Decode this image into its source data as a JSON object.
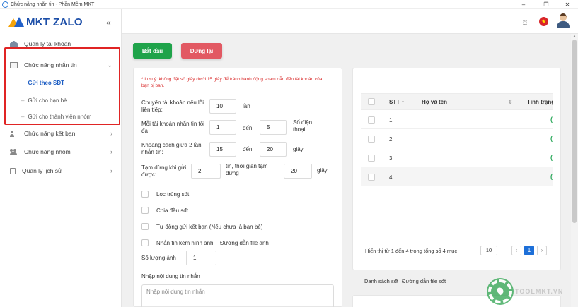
{
  "window": {
    "title": "Chức năng nhắn tin - Phần Mềm MKT",
    "minimize": "–",
    "maximize": "❐",
    "close": "✕"
  },
  "logo": {
    "text": "MKT ZALO"
  },
  "sidebar": {
    "collapse_glyph": "«",
    "items": [
      {
        "label": "Quản lý tài khoản",
        "icon": "house-icon"
      },
      {
        "label": "Chức năng nhắn tin",
        "icon": "mail-icon",
        "chevron": "⌄"
      },
      {
        "label": "Chức năng kết bạn",
        "icon": "user-plus-icon",
        "chevron": "›"
      },
      {
        "label": "Chức năng nhóm",
        "icon": "group-icon",
        "chevron": "›"
      },
      {
        "label": "Quản lý lịch sử",
        "icon": "clipboard-icon",
        "chevron": "›"
      }
    ],
    "sub_items": [
      {
        "label": "Gửi theo SĐT",
        "active": true
      },
      {
        "label": "Gửi cho bạn bè",
        "active": false
      },
      {
        "label": "Gửi cho thành viên nhóm",
        "active": false
      }
    ],
    "dash": "–",
    "highlight_color": "#e02424"
  },
  "header": {
    "theme_glyph": "☼",
    "flag_glyph": "★"
  },
  "actions": {
    "start_label": "Bắt đầu",
    "stop_label": "Dừng lại",
    "start_color": "#1fa34a",
    "stop_color": "#e25963"
  },
  "settings": {
    "warning": "* Lưu ý: không đặt số giây dưới 15 giây để tránh hành động spam dẫn đến tài khoản của bạn bị ban.",
    "switch_label": "Chuyển tài khoản nếu lỗi liên tiếp:",
    "switch_value": "10",
    "switch_unit": "lần",
    "per_account_label": "Mỗi tài khoản nhắn tin tối đa",
    "per_account_from": "1",
    "per_account_to_word": "đến",
    "per_account_to": "5",
    "per_account_unit": "Số điện thoại",
    "interval_label": "Khoảng cách giữa 2 lần nhắn tin:",
    "interval_from": "15",
    "interval_to_word": "đến",
    "interval_to": "20",
    "interval_unit": "giây",
    "pause_label": "Tạm dừng khi gửi được:",
    "pause_count": "2",
    "pause_mid": "tin, thời gian tạm dừng",
    "pause_seconds": "20",
    "pause_unit": "giây",
    "opt_dedupe": "Lọc trùng sđt",
    "opt_split": "Chia đều sđt",
    "opt_autofriend": "Tự động gửi kết bạn (Nếu chưa là bạn bè)",
    "opt_image": "Nhắn tin kèm hình ảnh",
    "image_link": "Đường dẫn file ảnh",
    "image_count_label": "Số lượng ảnh",
    "image_count": "1",
    "message_label": "Nhập nội dung tin nhắn",
    "message_placeholder": "Nhập nội dung tin nhắn"
  },
  "table": {
    "col_stt": "STT ↑",
    "col_name": "Họ và tên",
    "col_sort_glyph": "⇕",
    "col_status": "Tình trạng",
    "rows": [
      {
        "stt": "1",
        "status_glyph": "("
      },
      {
        "stt": "2",
        "status_glyph": "("
      },
      {
        "stt": "3",
        "status_glyph": "("
      },
      {
        "stt": "4",
        "status_glyph": "("
      }
    ],
    "footer_text": "Hiển thị từ 1 đến 4 trong tổng số 4 mục",
    "page_size": "10",
    "prev": "‹",
    "current_page": "1",
    "next": "›"
  },
  "phone_list": {
    "label": "Danh sách sđt",
    "link": "Đường dẫn file sđt"
  },
  "watermark": {
    "text": "TOOLMKT.VN"
  }
}
